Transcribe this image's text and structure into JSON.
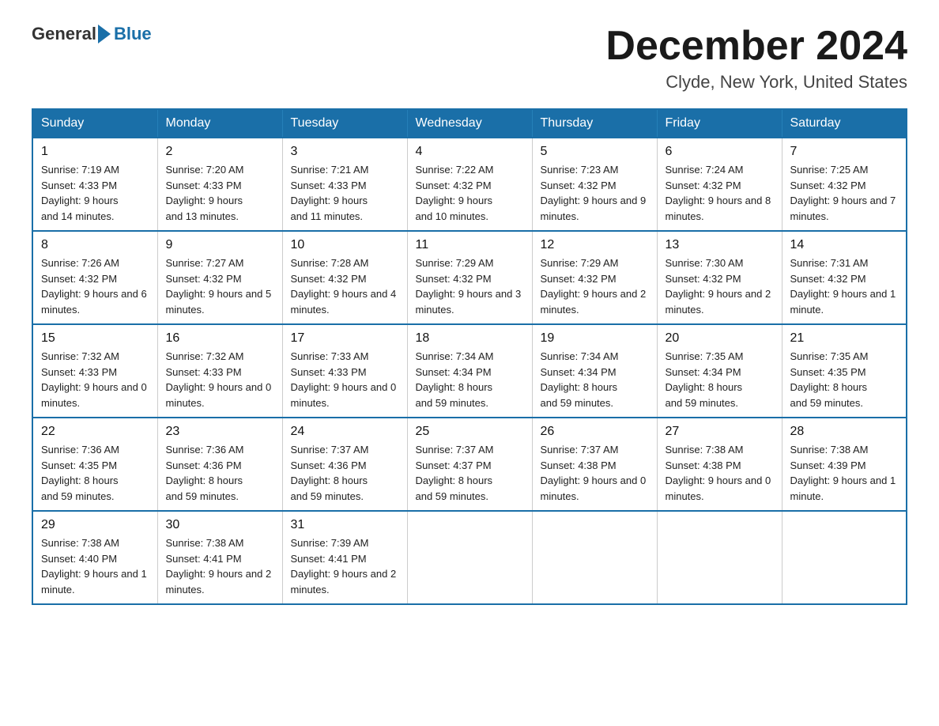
{
  "header": {
    "logo_general": "General",
    "logo_blue": "Blue",
    "month_title": "December 2024",
    "location": "Clyde, New York, United States"
  },
  "weekdays": [
    "Sunday",
    "Monday",
    "Tuesday",
    "Wednesday",
    "Thursday",
    "Friday",
    "Saturday"
  ],
  "weeks": [
    [
      {
        "day": "1",
        "sunrise": "7:19 AM",
        "sunset": "4:33 PM",
        "daylight": "9 hours and 14 minutes."
      },
      {
        "day": "2",
        "sunrise": "7:20 AM",
        "sunset": "4:33 PM",
        "daylight": "9 hours and 13 minutes."
      },
      {
        "day": "3",
        "sunrise": "7:21 AM",
        "sunset": "4:33 PM",
        "daylight": "9 hours and 11 minutes."
      },
      {
        "day": "4",
        "sunrise": "7:22 AM",
        "sunset": "4:32 PM",
        "daylight": "9 hours and 10 minutes."
      },
      {
        "day": "5",
        "sunrise": "7:23 AM",
        "sunset": "4:32 PM",
        "daylight": "9 hours and 9 minutes."
      },
      {
        "day": "6",
        "sunrise": "7:24 AM",
        "sunset": "4:32 PM",
        "daylight": "9 hours and 8 minutes."
      },
      {
        "day": "7",
        "sunrise": "7:25 AM",
        "sunset": "4:32 PM",
        "daylight": "9 hours and 7 minutes."
      }
    ],
    [
      {
        "day": "8",
        "sunrise": "7:26 AM",
        "sunset": "4:32 PM",
        "daylight": "9 hours and 6 minutes."
      },
      {
        "day": "9",
        "sunrise": "7:27 AM",
        "sunset": "4:32 PM",
        "daylight": "9 hours and 5 minutes."
      },
      {
        "day": "10",
        "sunrise": "7:28 AM",
        "sunset": "4:32 PM",
        "daylight": "9 hours and 4 minutes."
      },
      {
        "day": "11",
        "sunrise": "7:29 AM",
        "sunset": "4:32 PM",
        "daylight": "9 hours and 3 minutes."
      },
      {
        "day": "12",
        "sunrise": "7:29 AM",
        "sunset": "4:32 PM",
        "daylight": "9 hours and 2 minutes."
      },
      {
        "day": "13",
        "sunrise": "7:30 AM",
        "sunset": "4:32 PM",
        "daylight": "9 hours and 2 minutes."
      },
      {
        "day": "14",
        "sunrise": "7:31 AM",
        "sunset": "4:32 PM",
        "daylight": "9 hours and 1 minute."
      }
    ],
    [
      {
        "day": "15",
        "sunrise": "7:32 AM",
        "sunset": "4:33 PM",
        "daylight": "9 hours and 0 minutes."
      },
      {
        "day": "16",
        "sunrise": "7:32 AM",
        "sunset": "4:33 PM",
        "daylight": "9 hours and 0 minutes."
      },
      {
        "day": "17",
        "sunrise": "7:33 AM",
        "sunset": "4:33 PM",
        "daylight": "9 hours and 0 minutes."
      },
      {
        "day": "18",
        "sunrise": "7:34 AM",
        "sunset": "4:34 PM",
        "daylight": "8 hours and 59 minutes."
      },
      {
        "day": "19",
        "sunrise": "7:34 AM",
        "sunset": "4:34 PM",
        "daylight": "8 hours and 59 minutes."
      },
      {
        "day": "20",
        "sunrise": "7:35 AM",
        "sunset": "4:34 PM",
        "daylight": "8 hours and 59 minutes."
      },
      {
        "day": "21",
        "sunrise": "7:35 AM",
        "sunset": "4:35 PM",
        "daylight": "8 hours and 59 minutes."
      }
    ],
    [
      {
        "day": "22",
        "sunrise": "7:36 AM",
        "sunset": "4:35 PM",
        "daylight": "8 hours and 59 minutes."
      },
      {
        "day": "23",
        "sunrise": "7:36 AM",
        "sunset": "4:36 PM",
        "daylight": "8 hours and 59 minutes."
      },
      {
        "day": "24",
        "sunrise": "7:37 AM",
        "sunset": "4:36 PM",
        "daylight": "8 hours and 59 minutes."
      },
      {
        "day": "25",
        "sunrise": "7:37 AM",
        "sunset": "4:37 PM",
        "daylight": "8 hours and 59 minutes."
      },
      {
        "day": "26",
        "sunrise": "7:37 AM",
        "sunset": "4:38 PM",
        "daylight": "9 hours and 0 minutes."
      },
      {
        "day": "27",
        "sunrise": "7:38 AM",
        "sunset": "4:38 PM",
        "daylight": "9 hours and 0 minutes."
      },
      {
        "day": "28",
        "sunrise": "7:38 AM",
        "sunset": "4:39 PM",
        "daylight": "9 hours and 1 minute."
      }
    ],
    [
      {
        "day": "29",
        "sunrise": "7:38 AM",
        "sunset": "4:40 PM",
        "daylight": "9 hours and 1 minute."
      },
      {
        "day": "30",
        "sunrise": "7:38 AM",
        "sunset": "4:41 PM",
        "daylight": "9 hours and 2 minutes."
      },
      {
        "day": "31",
        "sunrise": "7:39 AM",
        "sunset": "4:41 PM",
        "daylight": "9 hours and 2 minutes."
      },
      null,
      null,
      null,
      null
    ]
  ],
  "labels": {
    "sunrise": "Sunrise: ",
    "sunset": "Sunset: ",
    "daylight": "Daylight: "
  }
}
